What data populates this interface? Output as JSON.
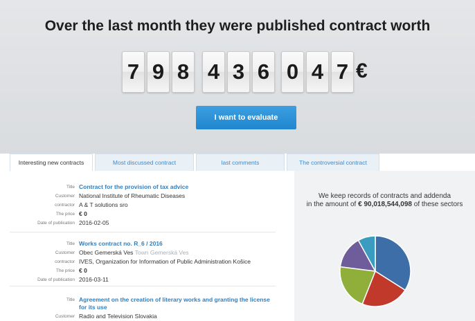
{
  "hero": {
    "title": "Over the last month they were published contract worth",
    "digits": [
      "7",
      "9",
      "8",
      "4",
      "3",
      "6",
      "0",
      "4",
      "7"
    ],
    "currency": "€",
    "cta_label": "I want to evaluate"
  },
  "tabs": [
    {
      "label": "Interesting new contracts",
      "active": true
    },
    {
      "label": "Most discussed contract",
      "active": false
    },
    {
      "label": "last comments",
      "active": false
    },
    {
      "label": "The controversial contract",
      "active": false
    }
  ],
  "labels": {
    "title": "Title",
    "customer": "Customer",
    "contractor": "contractor",
    "price": "The price",
    "date": "Date of publication"
  },
  "contracts": [
    {
      "title": "Contract for the provision of tax advice",
      "customer": "National Institute of Rheumatic Diseases",
      "customer_extra": "",
      "contractor": "A & T solutions sro",
      "price": "€ 0",
      "date": "2016-02-05"
    },
    {
      "title": "Works contract no. R_6 / 2016",
      "customer": "Obec Gemerská Ves",
      "customer_extra": "Town Gemerská Ves",
      "contractor": "IVES, Organization for Information of Public Administration Košice",
      "price": "€ 0",
      "date": "2016-03-11"
    },
    {
      "title": "Agreement on the creation of literary works and granting the license for its use",
      "customer": "Radio and Television Slovakia",
      "customer_extra": ""
    }
  ],
  "sidebar": {
    "line1": "We keep records of contracts and addenda",
    "line2_prefix": "in the amount of",
    "amount": "€ 90,018,544,098",
    "line2_suffix": "of these sectors"
  },
  "pie": {
    "colors": [
      "#3d6ea8",
      "#c0392b",
      "#8fae3a",
      "#6f5c9a",
      "#3a9cbf"
    ],
    "values": [
      34,
      22,
      21,
      15,
      8
    ]
  }
}
